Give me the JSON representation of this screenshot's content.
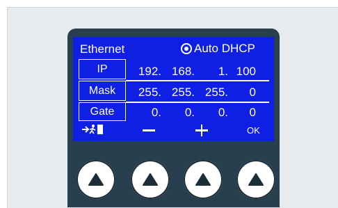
{
  "screen": {
    "title": "Ethernet",
    "dhcp_label": "Auto DHCP",
    "rows": [
      {
        "label": "IP",
        "octets": [
          "192.",
          "168.",
          "1.",
          "100"
        ]
      },
      {
        "label": "Mask",
        "octets": [
          "255.",
          "255.",
          "255.",
          "0"
        ]
      },
      {
        "label": "Gate",
        "octets": [
          "0.",
          "0.",
          "0.",
          "0"
        ]
      }
    ],
    "softkeys": {
      "ok_label": "OK"
    }
  },
  "colors": {
    "screen_bg": "#0f1fe3",
    "device_body": "#283f4e",
    "panel_bg": "#e8ebee"
  },
  "icons": [
    "exit-icon",
    "minus-icon",
    "plus-icon",
    "up-triangle-icon"
  ]
}
